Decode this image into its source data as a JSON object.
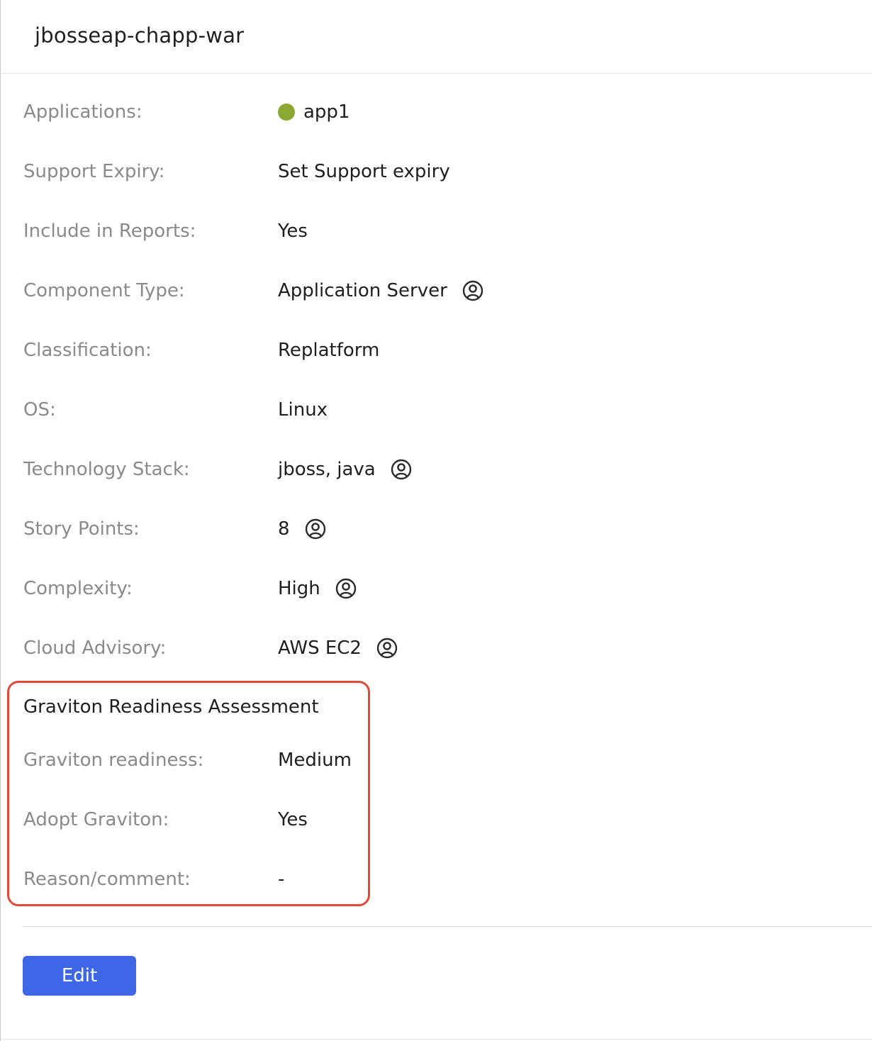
{
  "header": {
    "title": "jbosseap-chapp-war"
  },
  "fields": {
    "applications": {
      "label": "Applications:",
      "value": "app1",
      "status_color": "#8aa832"
    },
    "support_expiry": {
      "label": "Support Expiry:",
      "value": "Set Support expiry"
    },
    "include_in_reports": {
      "label": "Include in Reports:",
      "value": "Yes"
    },
    "component_type": {
      "label": "Component Type:",
      "value": "Application Server",
      "icon": "user-circle-icon"
    },
    "classification": {
      "label": "Classification:",
      "value": "Replatform"
    },
    "os": {
      "label": "OS:",
      "value": "Linux"
    },
    "technology_stack": {
      "label": "Technology Stack:",
      "value": "jboss, java",
      "icon": "user-circle-icon"
    },
    "story_points": {
      "label": "Story Points:",
      "value": "8",
      "icon": "user-circle-icon"
    },
    "complexity": {
      "label": "Complexity:",
      "value": "High",
      "icon": "user-circle-icon"
    },
    "cloud_advisory": {
      "label": "Cloud Advisory:",
      "value": "AWS EC2",
      "icon": "user-circle-icon"
    }
  },
  "graviton": {
    "section_title": "Graviton Readiness Assessment",
    "highlight_color": "#e04a39",
    "readiness": {
      "label": "Graviton readiness:",
      "value": "Medium"
    },
    "adopt": {
      "label": "Adopt Graviton:",
      "value": "Yes"
    },
    "reason": {
      "label": "Reason/comment:",
      "value": "-"
    }
  },
  "actions": {
    "edit_label": "Edit",
    "edit_color": "#3f66e6"
  }
}
